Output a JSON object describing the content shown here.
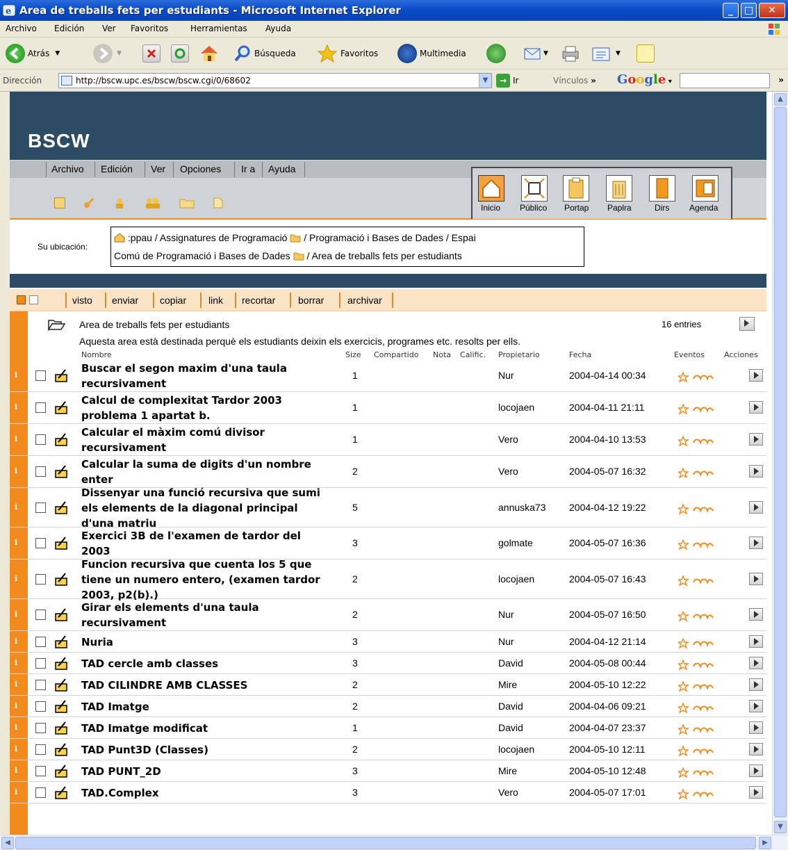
{
  "window": {
    "title": "Area de treballs fets per estudiants - Microsoft Internet Explorer"
  },
  "menubar": [
    "Archivo",
    "Edición",
    "Ver",
    "Favoritos",
    "Herramientas",
    "Ayuda"
  ],
  "toolbar": {
    "back": "Atrás",
    "search": "Búsqueda",
    "favorites": "Favoritos",
    "media": "Multimedia"
  },
  "address": {
    "label": "Dirección",
    "url": "http://bscw.upc.es/bscw/bscw.cgi/0/68602",
    "go": "Ir",
    "links": "Vínculos",
    "chevron": "»",
    "google": "Google"
  },
  "bscw": {
    "logo": "BSCW",
    "menu": [
      "Archivo",
      "Edición",
      "Ver",
      "Opciones",
      "Ir a",
      "Ayuda"
    ],
    "nav_buttons": [
      "Inicio",
      "Público",
      "Portap",
      "Paplra",
      "Dirs",
      "Agenda"
    ],
    "location_label": "Su ubicación:",
    "location_line1_a": ":ppau / Assignatures de Programació",
    "location_line1_b": "/ Programació i Bases de Dades / Espai",
    "location_line2_a": "Comú de Programació i Bases de Dades",
    "location_line2_b": "/ Area de treballs fets per estudiants",
    "actions": [
      "visto",
      "enviar",
      "copiar",
      "link",
      "recortar",
      "borrar",
      "archivar"
    ]
  },
  "folder": {
    "title": "Area de treballs fets per estudiants",
    "entries": "16 entries",
    "description": "Aquesta area està destinada perquè els estudiants deixin els exercicis, programes etc. resolts per ells."
  },
  "columns": {
    "name": "Nombre",
    "size": "Size",
    "shared": "Compartido",
    "note": "Nota",
    "rating": "Calific.",
    "owner": "Propietario",
    "date": "Fecha",
    "events": "Eventos",
    "actions": "Acciones"
  },
  "rows": [
    {
      "name_lines": [
        "Buscar el segon maxim d'una taula",
        "recursivament"
      ],
      "size": "1",
      "owner": "Nur",
      "date": "2004-04-14 00:34"
    },
    {
      "name_lines": [
        "Calcul de complexitat Tardor 2003",
        "problema 1 apartat b."
      ],
      "size": "1",
      "owner": "locojaen",
      "date": "2004-04-11 21:11"
    },
    {
      "name_lines": [
        "Calcular el màxim comú divisor",
        "recursivament"
      ],
      "size": "1",
      "owner": "Vero",
      "date": "2004-04-10 13:53"
    },
    {
      "name_lines": [
        "Calcular la suma de digits d'un nombre",
        "enter"
      ],
      "size": "2",
      "owner": "Vero",
      "date": "2004-05-07 16:32"
    },
    {
      "name_lines": [
        "Dissenyar una funció recursiva que sumi",
        "els elements de la diagonal principal",
        "d'una matriu"
      ],
      "size": "5",
      "owner": "annuska73",
      "date": "2004-04-12 19:22"
    },
    {
      "name_lines": [
        "Exercici 3B de l'examen de tardor del",
        "2003"
      ],
      "size": "3",
      "owner": "golmate",
      "date": "2004-05-07 16:36"
    },
    {
      "name_lines": [
        "Funcion recursiva que cuenta los 5 que",
        "tiene un numero entero, (examen tardor",
        "2003, p2(b).)"
      ],
      "size": "2",
      "owner": "locojaen",
      "date": "2004-05-07 16:43"
    },
    {
      "name_lines": [
        "Girar els elements d'una taula",
        "recursivament"
      ],
      "size": "2",
      "owner": "Nur",
      "date": "2004-05-07 16:50"
    },
    {
      "name_lines": [
        "Nuria"
      ],
      "size": "3",
      "owner": "Nur",
      "date": "2004-04-12 21:14"
    },
    {
      "name_lines": [
        "TAD cercle amb classes"
      ],
      "size": "3",
      "owner": "David",
      "date": "2004-05-08 00:44"
    },
    {
      "name_lines": [
        "TAD CILINDRE AMB CLASSES"
      ],
      "size": "2",
      "owner": "Mire",
      "date": "2004-05-10 12:22"
    },
    {
      "name_lines": [
        "TAD Imatge"
      ],
      "size": "2",
      "owner": "David",
      "date": "2004-04-06 09:21"
    },
    {
      "name_lines": [
        "TAD Imatge modificat"
      ],
      "size": "1",
      "owner": "David",
      "date": "2004-04-07 23:37"
    },
    {
      "name_lines": [
        "TAD Punt3D (Classes)"
      ],
      "size": "2",
      "owner": "locojaen",
      "date": "2004-05-10 12:11"
    },
    {
      "name_lines": [
        "TAD PUNT_2D"
      ],
      "size": "3",
      "owner": "Mire",
      "date": "2004-05-10 12:48"
    },
    {
      "name_lines": [
        "TAD.Complex"
      ],
      "size": "3",
      "owner": "Vero",
      "date": "2004-05-07 17:01"
    }
  ],
  "info_glyph": "i",
  "colors": {
    "xp_title": "#0a4cc8",
    "bscw_dark": "#2c4c66",
    "bscw_orange": "#f28a1e",
    "action_bar": "#fbe3c6"
  }
}
